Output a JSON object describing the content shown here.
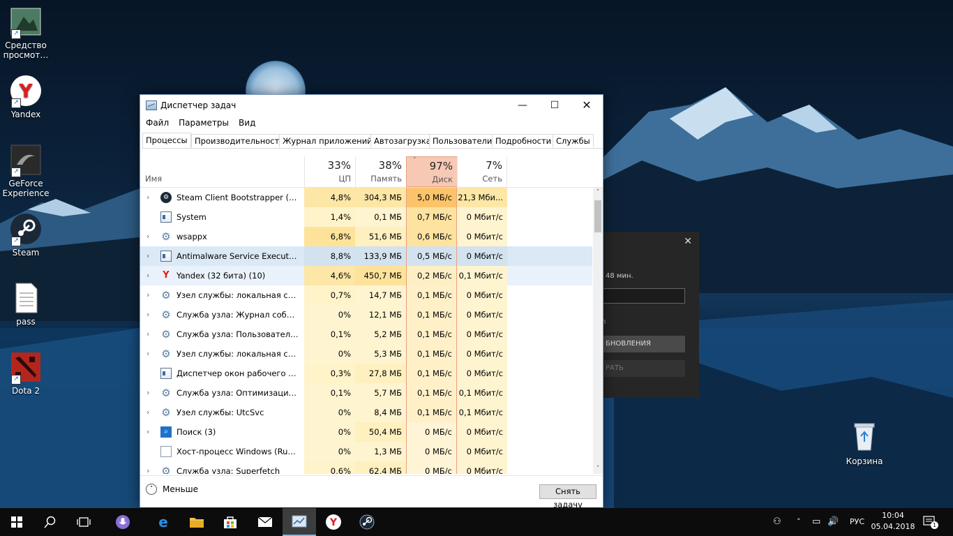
{
  "desktop": {
    "icons": [
      {
        "label": "Средство просмот…"
      },
      {
        "label": "Yandex"
      },
      {
        "label": "GeForce Experience"
      },
      {
        "label": "Steam"
      },
      {
        "label": "pass"
      },
      {
        "label": "Dota 2"
      }
    ],
    "recycle_bin": "Корзина"
  },
  "steam_dialog": {
    "time_text": "48 мин.",
    "letter": "л",
    "update_button": "БНОВЛЕНИЯ",
    "play_button": "РАТЬ"
  },
  "taskmanager": {
    "title": "Диспетчер задач",
    "window_buttons": {
      "minimize": "—",
      "maximize": "☐",
      "close": "✕"
    },
    "menu": [
      "Файл",
      "Параметры",
      "Вид"
    ],
    "tabs": [
      "Процессы",
      "Производительность",
      "Журнал приложений",
      "Автозагрузка",
      "Пользователи",
      "Подробности",
      "Службы"
    ],
    "columns": {
      "name": "Имя",
      "cpu": {
        "pct": "33%",
        "label": "ЦП"
      },
      "memory": {
        "pct": "38%",
        "label": "Память"
      },
      "disk": {
        "pct": "97%",
        "label": "Диск"
      },
      "network": {
        "pct": "7%",
        "label": "Сеть"
      }
    },
    "processes": [
      {
        "name": "Steam Client Bootstrapper (32 б...",
        "cpu": "4,8%",
        "mem": "304,3 МБ",
        "disk": "5,0 МБ/с",
        "net": "21,3 Мби..."
      },
      {
        "name": "System",
        "cpu": "1,4%",
        "mem": "0,1 МБ",
        "disk": "0,7 МБ/с",
        "net": "0 Мбит/с"
      },
      {
        "name": "wsappx",
        "cpu": "6,8%",
        "mem": "51,6 МБ",
        "disk": "0,6 МБ/с",
        "net": "0 Мбит/с"
      },
      {
        "name": "Antimalware Service Executable",
        "cpu": "8,8%",
        "mem": "133,9 МБ",
        "disk": "0,5 МБ/с",
        "net": "0 Мбит/с"
      },
      {
        "name": "Yandex (32 бита) (10)",
        "cpu": "4,6%",
        "mem": "450,7 МБ",
        "disk": "0,2 МБ/с",
        "net": "0,1 Мбит/с"
      },
      {
        "name": "Узел службы: локальная сист...",
        "cpu": "0,7%",
        "mem": "14,7 МБ",
        "disk": "0,1 МБ/с",
        "net": "0 Мбит/с"
      },
      {
        "name": "Служба узла: Журнал событи...",
        "cpu": "0%",
        "mem": "12,1 МБ",
        "disk": "0,1 МБ/с",
        "net": "0 Мбит/с"
      },
      {
        "name": "Служба узла: Пользовательск...",
        "cpu": "0,1%",
        "mem": "5,2 МБ",
        "disk": "0,1 МБ/с",
        "net": "0 Мбит/с"
      },
      {
        "name": "Узел службы: локальная сист...",
        "cpu": "0%",
        "mem": "5,3 МБ",
        "disk": "0,1 МБ/с",
        "net": "0 Мбит/с"
      },
      {
        "name": "Диспетчер окон рабочего сто...",
        "cpu": "0,3%",
        "mem": "27,8 МБ",
        "disk": "0,1 МБ/с",
        "net": "0 Мбит/с"
      },
      {
        "name": "Служба узла: Оптимизация до...",
        "cpu": "0,1%",
        "mem": "5,7 МБ",
        "disk": "0,1 МБ/с",
        "net": "0,1 Мбит/с"
      },
      {
        "name": "Узел службы: UtcSvc",
        "cpu": "0%",
        "mem": "8,4 МБ",
        "disk": "0,1 МБ/с",
        "net": "0,1 Мбит/с"
      },
      {
        "name": "Поиск (3)",
        "cpu": "0%",
        "mem": "50,4 МБ",
        "disk": "0 МБ/с",
        "net": "0 Мбит/с"
      },
      {
        "name": "Хост-процесс Windows (Rundl...",
        "cpu": "0%",
        "mem": "1,3 МБ",
        "disk": "0 МБ/с",
        "net": "0 Мбит/с"
      },
      {
        "name": "Служба узла: Superfetch",
        "cpu": "0,6%",
        "mem": "62,4 МБ",
        "disk": "0 МБ/с",
        "net": "0 Мбит/с"
      }
    ],
    "footer": {
      "fewer": "Меньше",
      "end_task": "Снять задачу"
    }
  },
  "taskbar": {
    "lang": "РУС",
    "time": "10:04",
    "date": "05.04.2018",
    "notification_count": "1"
  }
}
